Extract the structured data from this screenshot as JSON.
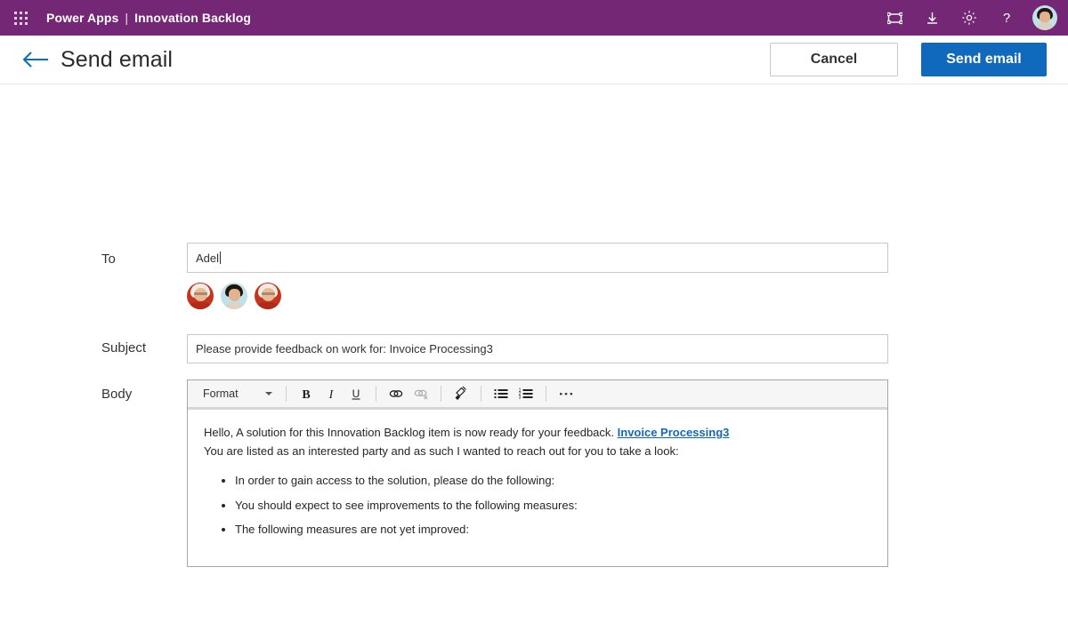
{
  "suite_bar": {
    "waffle_icon": "waffle-grid-icon",
    "app_name": "Power Apps",
    "separator": "|",
    "environment": "Innovation Backlog",
    "actions": [
      {
        "name": "fit-to-screen-icon",
        "label": "Fit to screen"
      },
      {
        "name": "download-icon",
        "label": "Download"
      },
      {
        "name": "settings-gear-icon",
        "label": "Settings"
      },
      {
        "name": "help-question-icon",
        "label": "Help"
      }
    ],
    "avatar": "user-avatar"
  },
  "command_bar": {
    "back_icon": "back-arrow-icon",
    "title": "Send email",
    "cancel_label": "Cancel",
    "send_label": "Send email"
  },
  "form": {
    "to": {
      "label": "To",
      "value": "Adel",
      "placeholder": "",
      "suggestions": [
        {
          "name": "person-avatar-1",
          "background": "#c4351f"
        },
        {
          "name": "person-avatar-2",
          "background": "#bfe1ea"
        },
        {
          "name": "person-avatar-3",
          "background": "#c4351f"
        }
      ]
    },
    "subject": {
      "label": "Subject",
      "value": "Please provide feedback on work for: Invoice Processing3",
      "placeholder": ""
    },
    "body": {
      "label": "Body",
      "toolbar": {
        "format_label": "Format",
        "buttons": [
          {
            "name": "bold-icon",
            "label": "B",
            "enabled": true
          },
          {
            "name": "italic-icon",
            "label": "I",
            "enabled": true
          },
          {
            "name": "underline-icon",
            "label": "U",
            "enabled": true
          },
          {
            "name": "link-icon",
            "label": "Insert link",
            "enabled": true
          },
          {
            "name": "unlink-icon",
            "label": "Remove link",
            "enabled": false
          },
          {
            "name": "format-painter-icon",
            "label": "Clear formatting",
            "enabled": true
          },
          {
            "name": "bulleted-list-icon",
            "label": "Bulleted list",
            "enabled": true
          },
          {
            "name": "numbered-list-icon",
            "label": "Numbered list",
            "enabled": true
          },
          {
            "name": "more-options-icon",
            "label": "…",
            "enabled": true
          }
        ]
      },
      "content": {
        "line1_before_link": "Hello, A solution for this Innovation Backlog item is now ready for your feedback. ",
        "link_text": "Invoice Processing3",
        "line2": "You are listed as an interested party and as such I wanted to reach out for you to take a look:",
        "bullets": [
          "In order to gain access to the solution, please do the following:",
          "You should expect to see improvements to the following measures:",
          "The following measures are not yet improved:"
        ]
      }
    }
  },
  "colors": {
    "suite_purple": "#742774",
    "primary_blue": "#1169bd",
    "link_blue": "#1168bd",
    "border_gray": "#c8c8c8",
    "editor_border": "#a6a6a6",
    "toolbar_bg": "#f6f6f6"
  }
}
